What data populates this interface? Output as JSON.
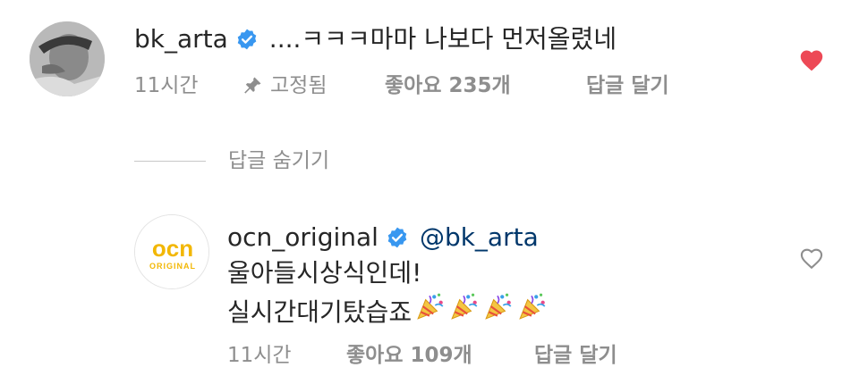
{
  "comment": {
    "username": "bk_arta",
    "text": "....ㅋㅋㅋ마마  나보다 먼저올렸네",
    "timestamp": "11시간",
    "pinned_label": "고정됨",
    "likes": "좋아요 235개",
    "reply_label": "답글 달기",
    "liked": true,
    "icons": [
      "verified-badge-icon",
      "pin-icon",
      "heart-filled-icon"
    ]
  },
  "hide_replies_label": "답글 숨기기",
  "reply": {
    "username": "ocn_original",
    "mention": "@bk_arta",
    "text_line1": "울아들시상식인데!",
    "text_line2": "실시간대기탔습죠",
    "emoji_count": 4,
    "avatar_logo_text": "ocn",
    "avatar_logo_sub": "ORIGINAL",
    "timestamp": "11시간",
    "likes": "좋아요 109개",
    "reply_label": "답글 달기",
    "liked": false,
    "icons": [
      "verified-badge-icon",
      "party-popper-icon",
      "heart-outline-icon"
    ]
  },
  "colors": {
    "text": "#262626",
    "secondary": "#8e8e8e",
    "verified": "#3897f0",
    "heart": "#ed4956",
    "mention": "#00376b",
    "ocn_yellow": "#f2b705"
  }
}
